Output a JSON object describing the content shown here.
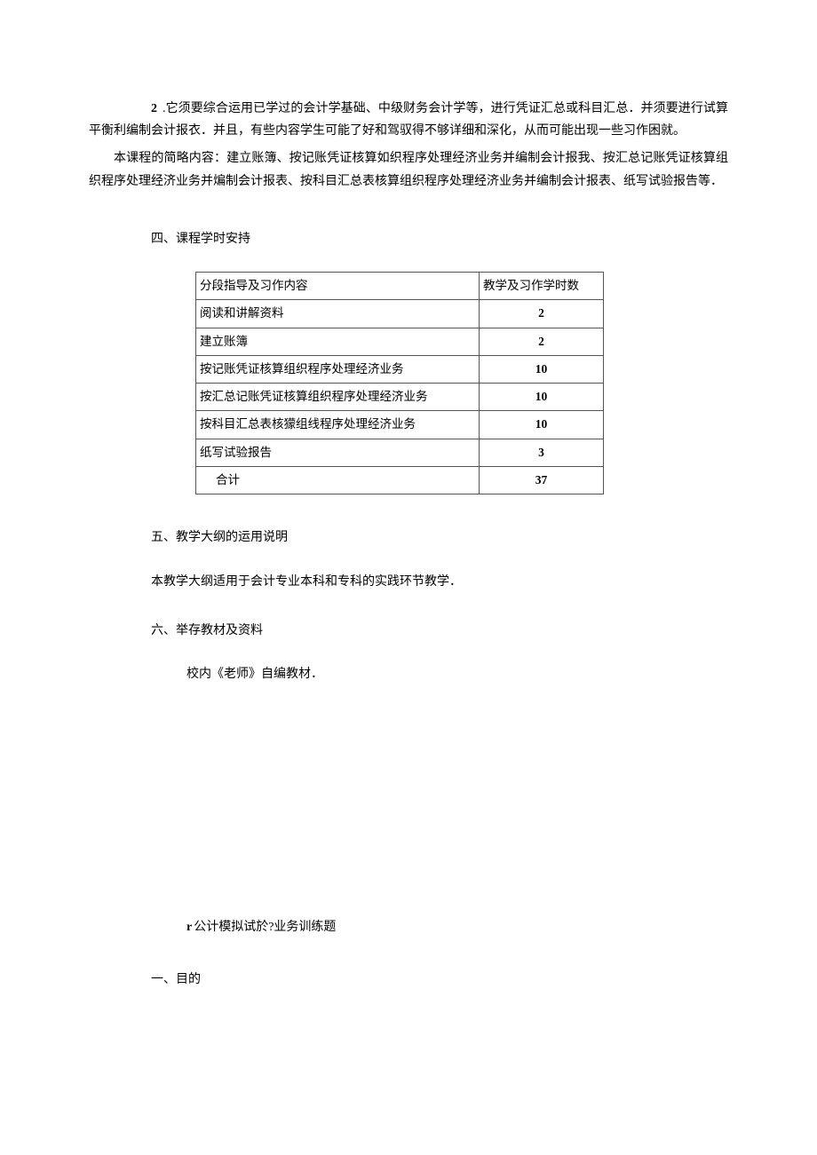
{
  "point2": {
    "num": "2",
    "text": ".它须要综合运用已学过的会计学基础、中级财务会计学等，进行凭证汇总或科目汇总．并须要进行试算平衡利编制会计报衣．并且，有些内容学生可能了好和驾驭得不够详细和深化，从而可能出现一些习作困就。"
  },
  "summary": "本课程的简略内容：建立账簿、按记账凭证核算如织程序处理经济业务并编制会计报我、按汇总记账凭证核算组织程序处理经济业务并煸制会计报表、按科目汇总表核算组织程序处理经济业务并编制会计报表、纸写试验报告等．",
  "section4": "四、课程学时安持",
  "table": {
    "header": {
      "content": "分段指导及习作内容",
      "hours": "教学及习作学时数"
    },
    "rows": [
      {
        "content": "阅读和讲解资料",
        "hours": "2"
      },
      {
        "content": "建立账簿",
        "hours": "2"
      },
      {
        "content": "按记账凭证核算组织程序处理经济业务",
        "hours": "10"
      },
      {
        "content": "按汇总记账凭证核算组织程序处理经济业务",
        "hours": "10"
      },
      {
        "content": "按科目汇总表核獴组线程序处理经济业务",
        "hours": "10"
      },
      {
        "content": "纸写试验报告",
        "hours": "3"
      }
    ],
    "total": {
      "label": "合计",
      "hours": "37"
    }
  },
  "section5": "五、教学大纲的运用说明",
  "section5_body": "本教学大纲适用于会计专业本科和专科的实践环节教学．",
  "section6": "六、举存教材及资料",
  "section6_body": "校内《老师》自编教材．",
  "exercise": {
    "prefix": "r",
    "title": "公计模拟试於?业务训练题"
  },
  "exercise_sec1": "一、目的"
}
